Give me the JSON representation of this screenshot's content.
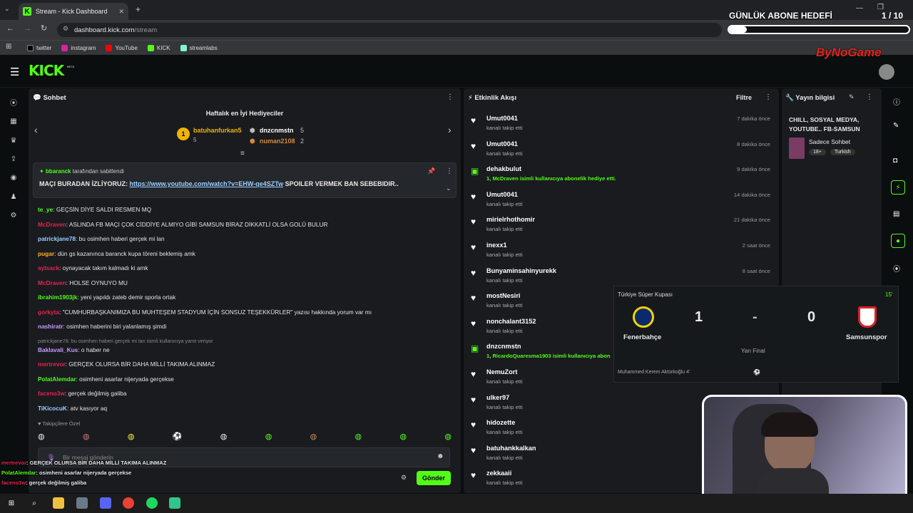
{
  "browser": {
    "tab_title": "Stream - Kick Dashboard",
    "url_host": "dashboard.kick.com",
    "url_path": "/stream",
    "bookmarks": [
      "twitter",
      "instagram",
      "YouTube",
      "KICK",
      "streamlabs"
    ]
  },
  "overlay": {
    "goal_label": "GÜNLÜK ABONE HEDEFİ",
    "goal_count": "1 / 10",
    "brand": "ByNoGame"
  },
  "app": {
    "logo": "KICK",
    "beta": "BETA"
  },
  "chat": {
    "title": "Sohbet",
    "gifters_title": "Haftalık en İyi Hediyeciler",
    "gifters": [
      {
        "rank": "1",
        "name": "batuhanfurkan5",
        "count": "5"
      },
      {
        "rank": "2",
        "name": "dnzcnmstn",
        "count": "5"
      },
      {
        "rank": "3",
        "name": "numan2108",
        "count": "2"
      }
    ],
    "pinned_by": "bbaranck",
    "pinned_suffix": "tarafından sabitlendi",
    "pinned_pre": "MAÇI BURADAN İZLİYORUZ: ",
    "pinned_link": "https://www.youtube.com/watch?v=EHW-qe4SZTw",
    "pinned_post": " SPOILER VERMEK BAN SEBEBIDIR..",
    "messages": [
      {
        "user": "te_ye",
        "color": "#53fc18",
        "text": "GEÇSİN DİYE SALDI RESMEN MQ"
      },
      {
        "user": "McDraven",
        "color": "#e8224d",
        "text": "ASLINDA FB MAÇI ÇOK CİDDİYE ALMIYO GİBİ SAMSUN BİRAZ DİKKATLİ OLSA GOLÜ BULUR"
      },
      {
        "user": "patrickjane78",
        "color": "#9bd0ff",
        "text": "bu osimhen haberi gerçek mi lan"
      },
      {
        "user": "pugar",
        "color": "#ffb020",
        "text": "dün gs kazanınca baranck kupa töreni beklemiş amk"
      },
      {
        "user": "aylsack",
        "color": "#e8224d",
        "text": "oynayacak takım kalmadı ki amk"
      },
      {
        "user": "McDraven",
        "color": "#e8224d",
        "text": "HOLSE OYNUYO MU"
      },
      {
        "user": "ibrahim1903jk",
        "color": "#53fc18",
        "text": "yeni yapıldı zateb demir sporla ortak"
      },
      {
        "user": "gorkyta",
        "color": "#e8224d",
        "text": "\"CUMHURBAŞKANIMIZA BU MUHTEŞEM STADYUM İÇİN SONSUZ TEŞEKKÜRLER\" yazısı hakkında yorum var mı"
      },
      {
        "user": "nashiratr",
        "color": "#c89bff",
        "text": "osimhen haberini biri yalanlamış şimdi"
      },
      {
        "user": "Baklavali_Kus",
        "color": "#c89bff",
        "text": "o haber ne"
      },
      {
        "user": "mertrevor",
        "color": "#e8224d",
        "text": "GERÇEK OLURSA BİR DAHA MİLLİ TAKIMA ALINMAZ"
      },
      {
        "user": "PolatAlemdar",
        "color": "#53fc18",
        "text": "osimheni asarlar nijeryada gerçekse"
      },
      {
        "user": "faceno3w",
        "color": "#e8224d",
        "text": "gerçek değilmiş galiba"
      },
      {
        "user": "TiKicocuK",
        "color": "#9bd0ff",
        "text": "atv kasıyor aq"
      }
    ],
    "reply_note": "patrickjane78: bu osimhen haberi gerçek mi lan isimli kullanıcıya yanıt veriyor",
    "emote_label": "Takipçilere Özel",
    "input_placeholder": "Bir mesaj gönderin",
    "send_label": "Gönder"
  },
  "overlay_chat": [
    {
      "user": "mertrevor",
      "text": "GERÇEK OLURSA BİR DAHA MİLLİ TAKIMA ALINMAZ",
      "color": "#e8224d"
    },
    {
      "user": "PolatAlemdar",
      "text": "osimheni asarlar nijeryada gerçekse",
      "color": "#53fc18"
    },
    {
      "user": "faceno3w",
      "text": "gerçek değilmiş galiba",
      "color": "#e8224d"
    }
  ],
  "activity": {
    "title": "Etkinlik Akışı",
    "filter_label": "Filtre",
    "events": [
      {
        "name": "Umut0041",
        "sub": "kanalı takip etti",
        "time": "7 dakika önce",
        "type": "follow"
      },
      {
        "name": "Umut0041",
        "sub": "kanalı takip etti",
        "time": "8 dakika önce",
        "type": "follow"
      },
      {
        "name": "dehakbulut",
        "sub": "1, McDraven isimli kullanıcıya abonelik hediye etti.",
        "time": "9 dakika önce",
        "type": "gift"
      },
      {
        "name": "Umut0041",
        "sub": "kanalı takip etti",
        "time": "14 dakika önce",
        "type": "follow"
      },
      {
        "name": "mirielrhothomir",
        "sub": "kanalı takip etti",
        "time": "21 dakika önce",
        "type": "follow"
      },
      {
        "name": "inexx1",
        "sub": "kanalı takip etti",
        "time": "2 saat önce",
        "type": "follow"
      },
      {
        "name": "Bunyaminsahinyurekk",
        "sub": "kanalı takip etti",
        "time": "8 saat önce",
        "type": "follow"
      },
      {
        "name": "mostNesiri",
        "sub": "kanalı takip etti",
        "time": "",
        "type": "follow"
      },
      {
        "name": "nonchalant3152",
        "sub": "kanalı takip etti",
        "time": "",
        "type": "follow"
      },
      {
        "name": "dnzcnmstn",
        "sub": "1, RicardoQuaresma1903 isimli kullanıcıya abon",
        "time": "",
        "type": "gift"
      },
      {
        "name": "NemuZort",
        "sub": "kanalı takip etti",
        "time": "",
        "type": "follow"
      },
      {
        "name": "ulker97",
        "sub": "kanalı takip etti",
        "time": "",
        "type": "follow"
      },
      {
        "name": "hidozette",
        "sub": "kanalı takip etti",
        "time": "",
        "type": "follow"
      },
      {
        "name": "batuhankkalkan",
        "sub": "kanalı takip etti",
        "time": "",
        "type": "follow"
      },
      {
        "name": "zekkaaii",
        "sub": "kanalı takip etti",
        "time": "",
        "type": "follow"
      }
    ]
  },
  "stream_info": {
    "title": "Yayın bilgisi",
    "stream_title": "CHILL, SOSYAL MEDYA, YOUTUBE.. FB-SAMSUN",
    "category": "Sadece Sohbet",
    "tags": [
      "18+",
      "Turkish"
    ]
  },
  "scoreboard": {
    "competition": "Türkiye Süper Kupası",
    "minute": "15'",
    "home_team": "Fenerbahçe",
    "away_team": "Samsunspor",
    "home_score": "1",
    "away_score": "0",
    "separator": "-",
    "stage": "Yarı Final",
    "scorer": "Muhammed Kerem Aktürkoğlu 4'"
  },
  "colors": {
    "accent": "#53fc18",
    "panel": "#191b1f",
    "bg": "#0b0e0f"
  }
}
